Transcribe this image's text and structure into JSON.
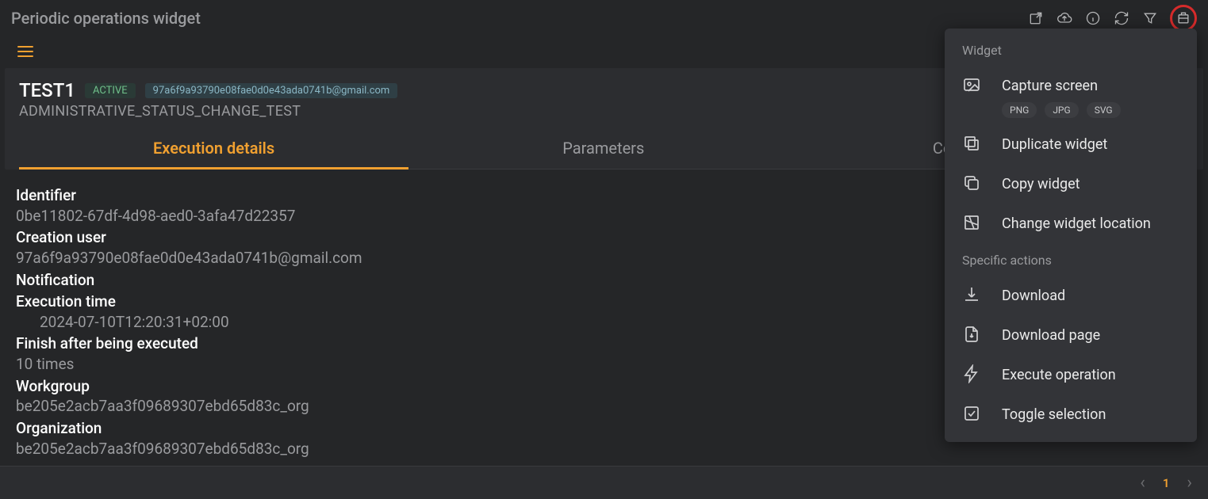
{
  "title": "Periodic operations widget",
  "card": {
    "name": "TEST1",
    "status": "ACTIVE",
    "email": "97a6f9a93790e08fae0d0e43ada0741b@gmail.com",
    "subtitle": "ADMINISTRATIVE_STATUS_CHANGE_TEST"
  },
  "tabs": [
    {
      "label": "Execution details"
    },
    {
      "label": "Parameters"
    },
    {
      "label": "Configured times"
    }
  ],
  "details": {
    "identifier_label": "Identifier",
    "identifier_value": "0be11802-67df-4d98-aed0-3afa47d22357",
    "creation_user_label": "Creation user",
    "creation_user_value": "97a6f9a93790e08fae0d0e43ada0741b@gmail.com",
    "notification_label": "Notification",
    "notification_value": "",
    "execution_time_label": "Execution time",
    "execution_time_value": "2024-07-10T12:20:31+02:00",
    "finish_after_label": "Finish after being executed",
    "finish_after_value": "10 times",
    "workgroup_label": "Workgroup",
    "workgroup_value": "be205e2acb7aa3f09689307ebd65d83c_org",
    "organization_label": "Organization",
    "organization_value": "be205e2acb7aa3f09689307ebd65d83c_org"
  },
  "pagination": {
    "page": "1"
  },
  "menu": {
    "section1": "Widget",
    "capture_screen": "Capture screen",
    "formats": {
      "png": "PNG",
      "jpg": "JPG",
      "svg": "SVG"
    },
    "duplicate": "Duplicate widget",
    "copy": "Copy widget",
    "change_location": "Change widget location",
    "section2": "Specific actions",
    "download": "Download",
    "download_page": "Download page",
    "execute": "Execute operation",
    "toggle_selection": "Toggle selection"
  }
}
